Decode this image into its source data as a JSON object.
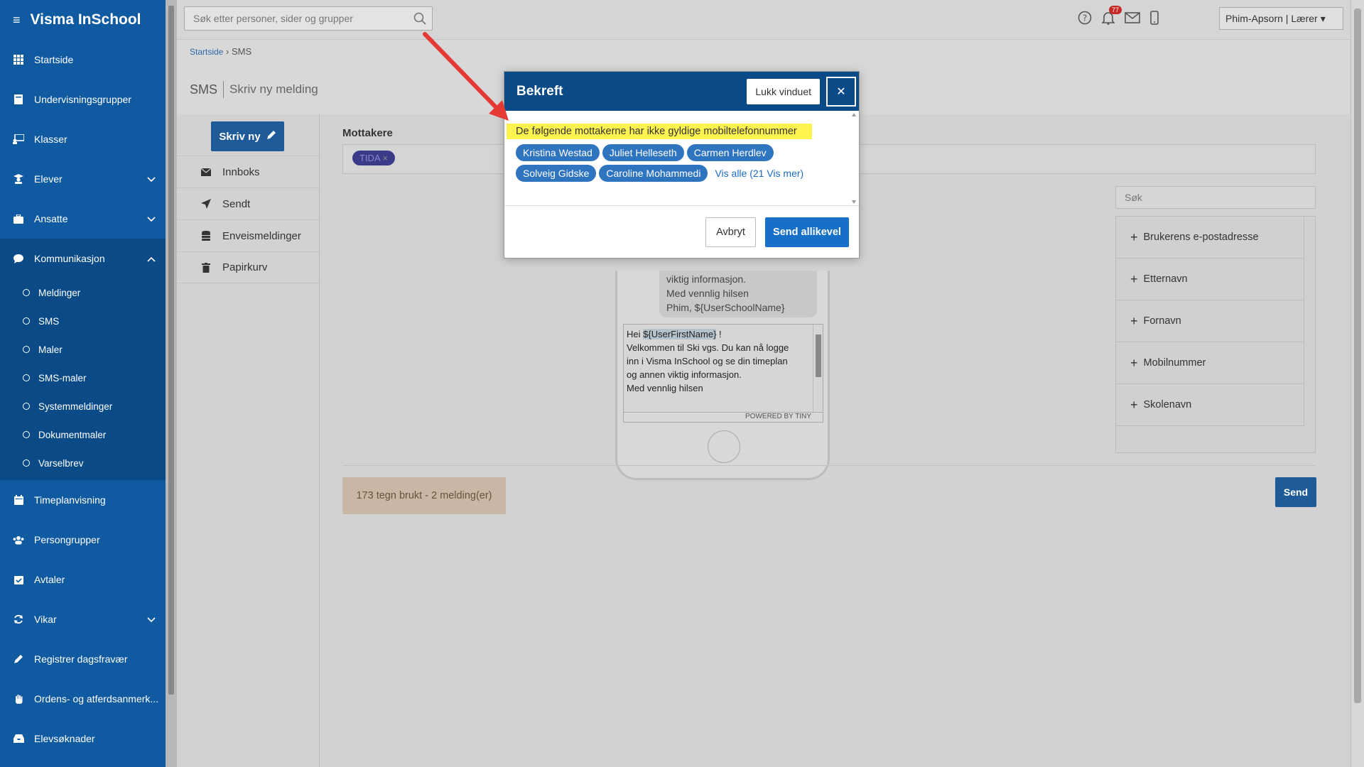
{
  "app": {
    "title": "Visma InSchool"
  },
  "topbar": {
    "search_placeholder": "Søk etter personer, sider og grupper",
    "notification_count": "77",
    "user": "Phim-Apsorn | Lærer"
  },
  "sidebar": {
    "items": [
      {
        "label": "Startside",
        "icon": "grid-icon"
      },
      {
        "label": "Undervisningsgrupper",
        "icon": "book-icon"
      },
      {
        "label": "Klasser",
        "icon": "board-icon"
      },
      {
        "label": "Elever",
        "icon": "student-icon"
      },
      {
        "label": "Ansatte",
        "icon": "briefcase-icon"
      },
      {
        "label": "Kommunikasjon",
        "icon": "chat-icon"
      }
    ],
    "sub_items": [
      "Meldinger",
      "SMS",
      "Maler",
      "SMS-maler",
      "Systemmeldinger",
      "Dokumentmaler",
      "Varselbrev"
    ],
    "items_after": [
      {
        "label": "Timeplanvisning",
        "icon": "calendar-icon"
      },
      {
        "label": "Persongrupper",
        "icon": "users-icon"
      },
      {
        "label": "Avtaler",
        "icon": "calendar-check-icon"
      },
      {
        "label": "Vikar",
        "icon": "refresh-icon"
      },
      {
        "label": "Registrer dagsfravær",
        "icon": "pencil-icon"
      },
      {
        "label": "Ordens- og atferdsanmerk...",
        "icon": "hand-icon"
      },
      {
        "label": "Elevsøknader",
        "icon": "inbox-icon"
      }
    ]
  },
  "breadcrumb": {
    "home": "Startside",
    "current": "SMS"
  },
  "page": {
    "title": "SMS",
    "subtitle": "Skriv ny melding"
  },
  "leftnav": {
    "new_button": "Skriv ny",
    "items": [
      "Innboks",
      "Sendt",
      "Enveismeldinger",
      "Papirkurv"
    ]
  },
  "composer": {
    "recipients_label": "Mottakere",
    "recipient_chip": "TIDA",
    "preview_lines": [
      "viktig informasjon.",
      "Med vennlig hilsen",
      "Phim, ${UserSchoolName}"
    ],
    "editor_prefix": "Hei ",
    "editor_tag": "${UserFirstName}",
    "editor_suffix": " !",
    "editor_lines": [
      "Velkommen til Ski vgs. Du kan nå logge",
      "inn i Visma InSchool og se din timeplan",
      "og annen viktig informasjon.",
      "Med vennlig hilsen"
    ],
    "powered_by": "POWERED BY TINY",
    "right_search_placeholder": "Søk",
    "fields": [
      "Brukerens e-postadresse",
      "Etternavn",
      "Fornavn",
      "Mobilnummer",
      "Skolenavn"
    ],
    "char_count": "173 tegn brukt - 2 melding(er)",
    "send_button": "Send"
  },
  "modal": {
    "title": "Bekreft",
    "close_tooltip": "Lukk vinduet",
    "warning": "De følgende mottakerne har ikke gyldige mobiltelefonnummer",
    "recipients": [
      "Kristina Westad",
      "Juliet Helleseth",
      "Carmen Herdlev",
      "Solveig Gidske",
      "Caroline Mohammedi"
    ],
    "show_all": "Vis alle (21 Vis mer)",
    "cancel": "Avbryt",
    "confirm": "Send allikevel"
  },
  "colors": {
    "brand": "#0f5aa0",
    "primary_button": "#1670c8",
    "highlight": "#fff44f",
    "annotation_arrow": "#e53935"
  }
}
